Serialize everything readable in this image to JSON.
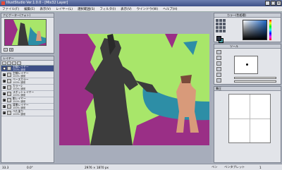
{
  "window": {
    "title": "IllustStudio Ver.1.0.0 - [Mix32 Layer]"
  },
  "menu": [
    "ファイル(F)",
    "編集(E)",
    "表示(V)",
    "レイヤー(L)",
    "選択範囲(S)",
    "フィルタ(I)",
    "表示(V)",
    "ウインドウ(W)",
    "ヘルプ(H)"
  ],
  "navigator": {
    "title": "ナビゲーター(フォト)",
    "zoom_out": "-",
    "zoom_in": "+"
  },
  "layers": {
    "title": "レイヤー",
    "rows": [
      {
        "name": "主線レイヤー",
        "opacity": "100% 通常",
        "active": true
      },
      {
        "name": "主線レイヤー",
        "opacity": "100% 通常",
        "active": false
      },
      {
        "name": "ベースカラー",
        "opacity": "100% 通常",
        "active": false
      },
      {
        "name": "カラー2",
        "opacity": "100% 通常",
        "active": false
      },
      {
        "name": "スポットレイヤー",
        "opacity": "100% 通常",
        "active": false
      },
      {
        "name": "影レイヤー",
        "opacity": "100% 通常",
        "active": false
      },
      {
        "name": "背景レイヤー",
        "opacity": "100% 通常",
        "active": false
      },
      {
        "name": "べた塗り",
        "opacity": "100% 通常",
        "active": false
      }
    ]
  },
  "color_panel": {
    "title": "カラー(色相環)"
  },
  "tool_panel": {
    "title": "ツール"
  },
  "brush_panel": {
    "title": "ブラシサイズ"
  },
  "pressure_panel": {
    "title": "筆圧"
  },
  "status": {
    "zoom": "33.3",
    "angle": "0.0°",
    "size": "2976 × 1870 px",
    "tool": "ペン",
    "pen_label": "ペンタブレット",
    "pen_value": "1"
  },
  "colors": {
    "canvas_bg": "#a8e66a",
    "magenta": "#9a2f86",
    "teal": "#2d8ea6",
    "title_blue": "#3e5088"
  }
}
